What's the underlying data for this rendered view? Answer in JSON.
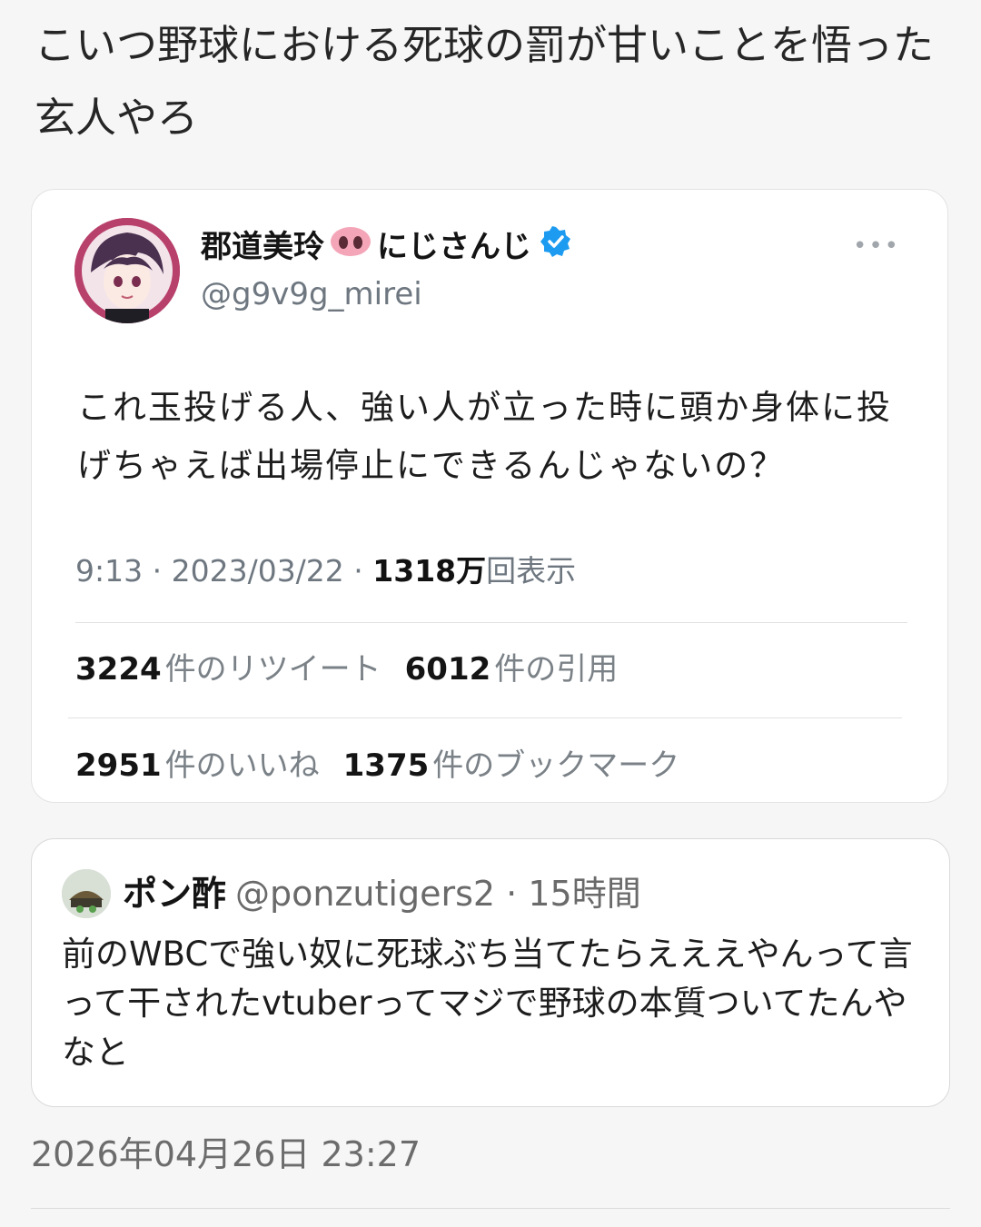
{
  "post": {
    "text": "こいつ野球における死球の罰が甘いことを悟った玄人やろ"
  },
  "embedded_tweet": {
    "display_name": "郡道美玲",
    "display_name_suffix": "にじさんじ",
    "handle": "@g9v9g_mirei",
    "body": "これ玉投げる人、強い人が立った時に頭か身体に投げちゃえば出場停止にできるんじゃないの？",
    "time": "9:13",
    "date": "2023/03/22",
    "views_count": "1318万",
    "views_label": "回表示",
    "retweets_count": "3224",
    "retweets_label": "件のリツイート",
    "quotes_count": "6012",
    "quotes_label": "件の引用",
    "likes_count": "2951",
    "likes_label": "件のいいね",
    "bookmarks_count": "1375",
    "bookmarks_label": "件のブックマーク",
    "more_icon": "more-horizontal-icon",
    "verified_color": "#1d9bf0"
  },
  "quote": {
    "name": "ポン酢",
    "handle": "@ponzutigers2",
    "separator": "·",
    "time_ago": "15時間",
    "body": "前のWBCで強い奴に死球ぶち当てたらえええやんって言って干されたvtuberってマジで野球の本質ついてたんやなと"
  },
  "footer": {
    "timestamp": "2026年04月26日 23:27"
  }
}
